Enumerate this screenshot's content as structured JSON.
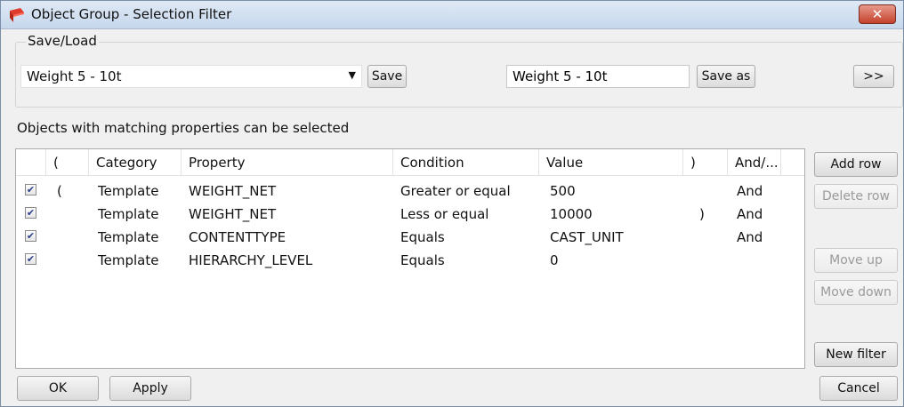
{
  "window": {
    "title": "Object Group - Selection Filter",
    "close_label": "✕"
  },
  "saveload": {
    "group_label": "Save/Load",
    "selected_filter": "Weight 5 - 10t",
    "save_label": "Save",
    "save_as_name": "Weight 5 - 10t",
    "save_as_label": "Save as",
    "expand_label": ">>"
  },
  "info_text": "Objects with matching properties can be selected",
  "table": {
    "headers": [
      "(",
      "Category",
      "Property",
      "Condition",
      "Value",
      ")",
      "And/..."
    ],
    "rows": [
      {
        "checked": true,
        "open": "(",
        "category": "Template",
        "property": "WEIGHT_NET",
        "condition": "Greater or equal",
        "value": "500",
        "close": "",
        "andor": "And"
      },
      {
        "checked": true,
        "open": "",
        "category": "Template",
        "property": "WEIGHT_NET",
        "condition": "Less or equal",
        "value": "10000",
        "close": ")",
        "andor": "And"
      },
      {
        "checked": true,
        "open": "",
        "category": "Template",
        "property": "CONTENTTYPE",
        "condition": "Equals",
        "value": "CAST_UNIT",
        "close": "",
        "andor": "And"
      },
      {
        "checked": true,
        "open": "",
        "category": "Template",
        "property": "HIERARCHY_LEVEL",
        "condition": "Equals",
        "value": "0",
        "close": "",
        "andor": ""
      }
    ]
  },
  "side_buttons": {
    "add_row": "Add row",
    "delete_row": "Delete row",
    "move_up": "Move up",
    "move_down": "Move down",
    "new_filter": "New filter"
  },
  "footer": {
    "ok": "OK",
    "apply": "Apply",
    "cancel": "Cancel"
  },
  "colors": {
    "title_gradient_top": "#dfe9f5",
    "close_red": "#c4412b",
    "check_blue": "#2a3e8a"
  }
}
